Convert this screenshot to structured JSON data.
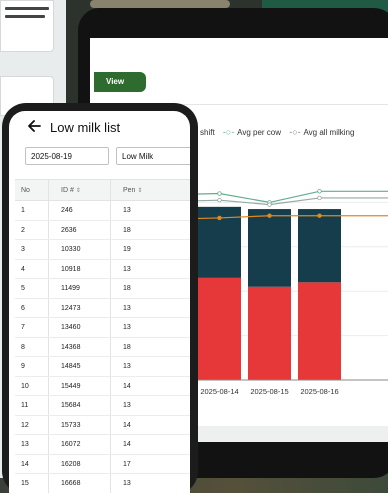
{
  "tablet": {
    "view_button": "View",
    "legend": [
      {
        "marker": "",
        "label": "shift",
        "color": "#333333"
      },
      {
        "marker": "-○-",
        "label": "Avg per cow",
        "color": "#5fae90"
      },
      {
        "marker": "-○-",
        "label": "Avg all milking",
        "color": "#7d8a86"
      }
    ]
  },
  "chart_data": {
    "type": "bar",
    "stacked": true,
    "categories": [
      "2025-08-14",
      "2025-08-15",
      "2025-08-16"
    ],
    "series": [
      {
        "name": "",
        "color": "#e63838",
        "values": [
          46,
          42,
          44
        ]
      },
      {
        "name": "",
        "color": "#163d4c",
        "values": [
          32,
          35,
          33
        ]
      }
    ],
    "lines": [
      {
        "name": "Avg per cow",
        "color": "#5fae90",
        "values": [
          84,
          80,
          85
        ]
      },
      {
        "name": "Avg all milking",
        "color": "#e08a1e",
        "values": [
          73,
          74,
          74
        ]
      },
      {
        "name": "",
        "color": "#9aa8a4",
        "values": [
          81,
          79,
          82
        ]
      }
    ],
    "ylim": [
      0,
      100
    ]
  },
  "phone": {
    "title": "Low milk list",
    "date_field": "2025-08-19",
    "type_field": "Low Milk",
    "table": {
      "headers": [
        "No",
        "ID #",
        "Pen"
      ],
      "rows": [
        [
          "1",
          "246",
          "13"
        ],
        [
          "2",
          "2636",
          "18"
        ],
        [
          "3",
          "10330",
          "19"
        ],
        [
          "4",
          "10918",
          "13"
        ],
        [
          "5",
          "11499",
          "18"
        ],
        [
          "6",
          "12473",
          "13"
        ],
        [
          "7",
          "13460",
          "13"
        ],
        [
          "8",
          "14368",
          "18"
        ],
        [
          "9",
          "14845",
          "13"
        ],
        [
          "10",
          "15449",
          "14"
        ],
        [
          "11",
          "15684",
          "13"
        ],
        [
          "12",
          "15733",
          "14"
        ],
        [
          "13",
          "16072",
          "14"
        ],
        [
          "14",
          "16208",
          "17"
        ],
        [
          "15",
          "16668",
          "13"
        ]
      ]
    }
  }
}
